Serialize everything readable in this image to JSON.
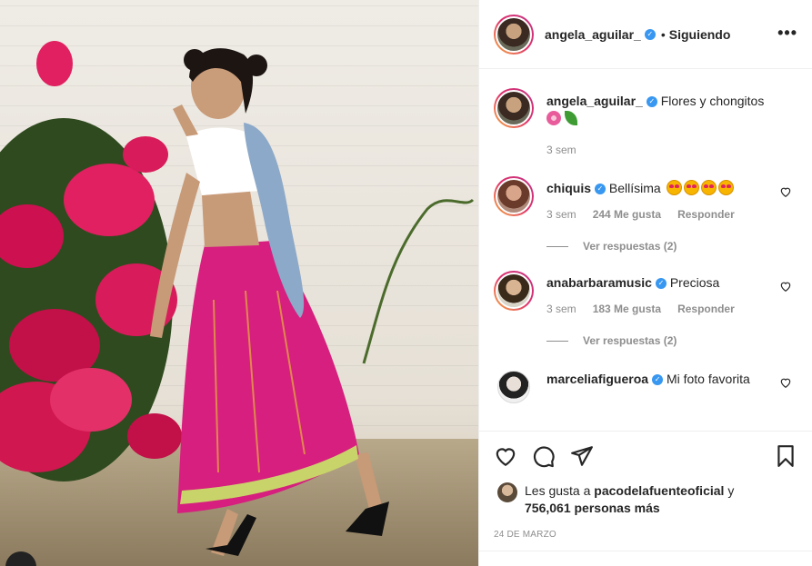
{
  "post": {
    "author": "angela_aguilar_",
    "follow_status": "Siguiendo",
    "more_label": "•••",
    "caption": "Flores y chongitos",
    "caption_time": "3 sem"
  },
  "comments": [
    {
      "user": "chiquis",
      "text": "Bellísima",
      "time": "3 sem",
      "likes": "244 Me gusta",
      "reply": "Responder",
      "view_replies": "Ver respuestas (2)"
    },
    {
      "user": "anabarbaramusic",
      "text": "Preciosa",
      "time": "3 sem",
      "likes": "183 Me gusta",
      "reply": "Responder",
      "view_replies": "Ver respuestas (2)"
    },
    {
      "user": "marceliafigueroa",
      "text": "Mi foto favorita"
    }
  ],
  "likes_summary": {
    "prefix": "Les gusta a",
    "user": "pacodelafuenteoficial",
    "conj": "y",
    "others": "756,061 personas más"
  },
  "date": "24 DE MARZO",
  "icons": {
    "like": "heart-icon",
    "comment": "comment-icon",
    "share": "share-icon",
    "save": "bookmark-icon",
    "verified": "verified-badge-icon"
  },
  "colors": {
    "verified": "#3897f0",
    "muted": "#8e8e8e",
    "text": "#262626"
  }
}
